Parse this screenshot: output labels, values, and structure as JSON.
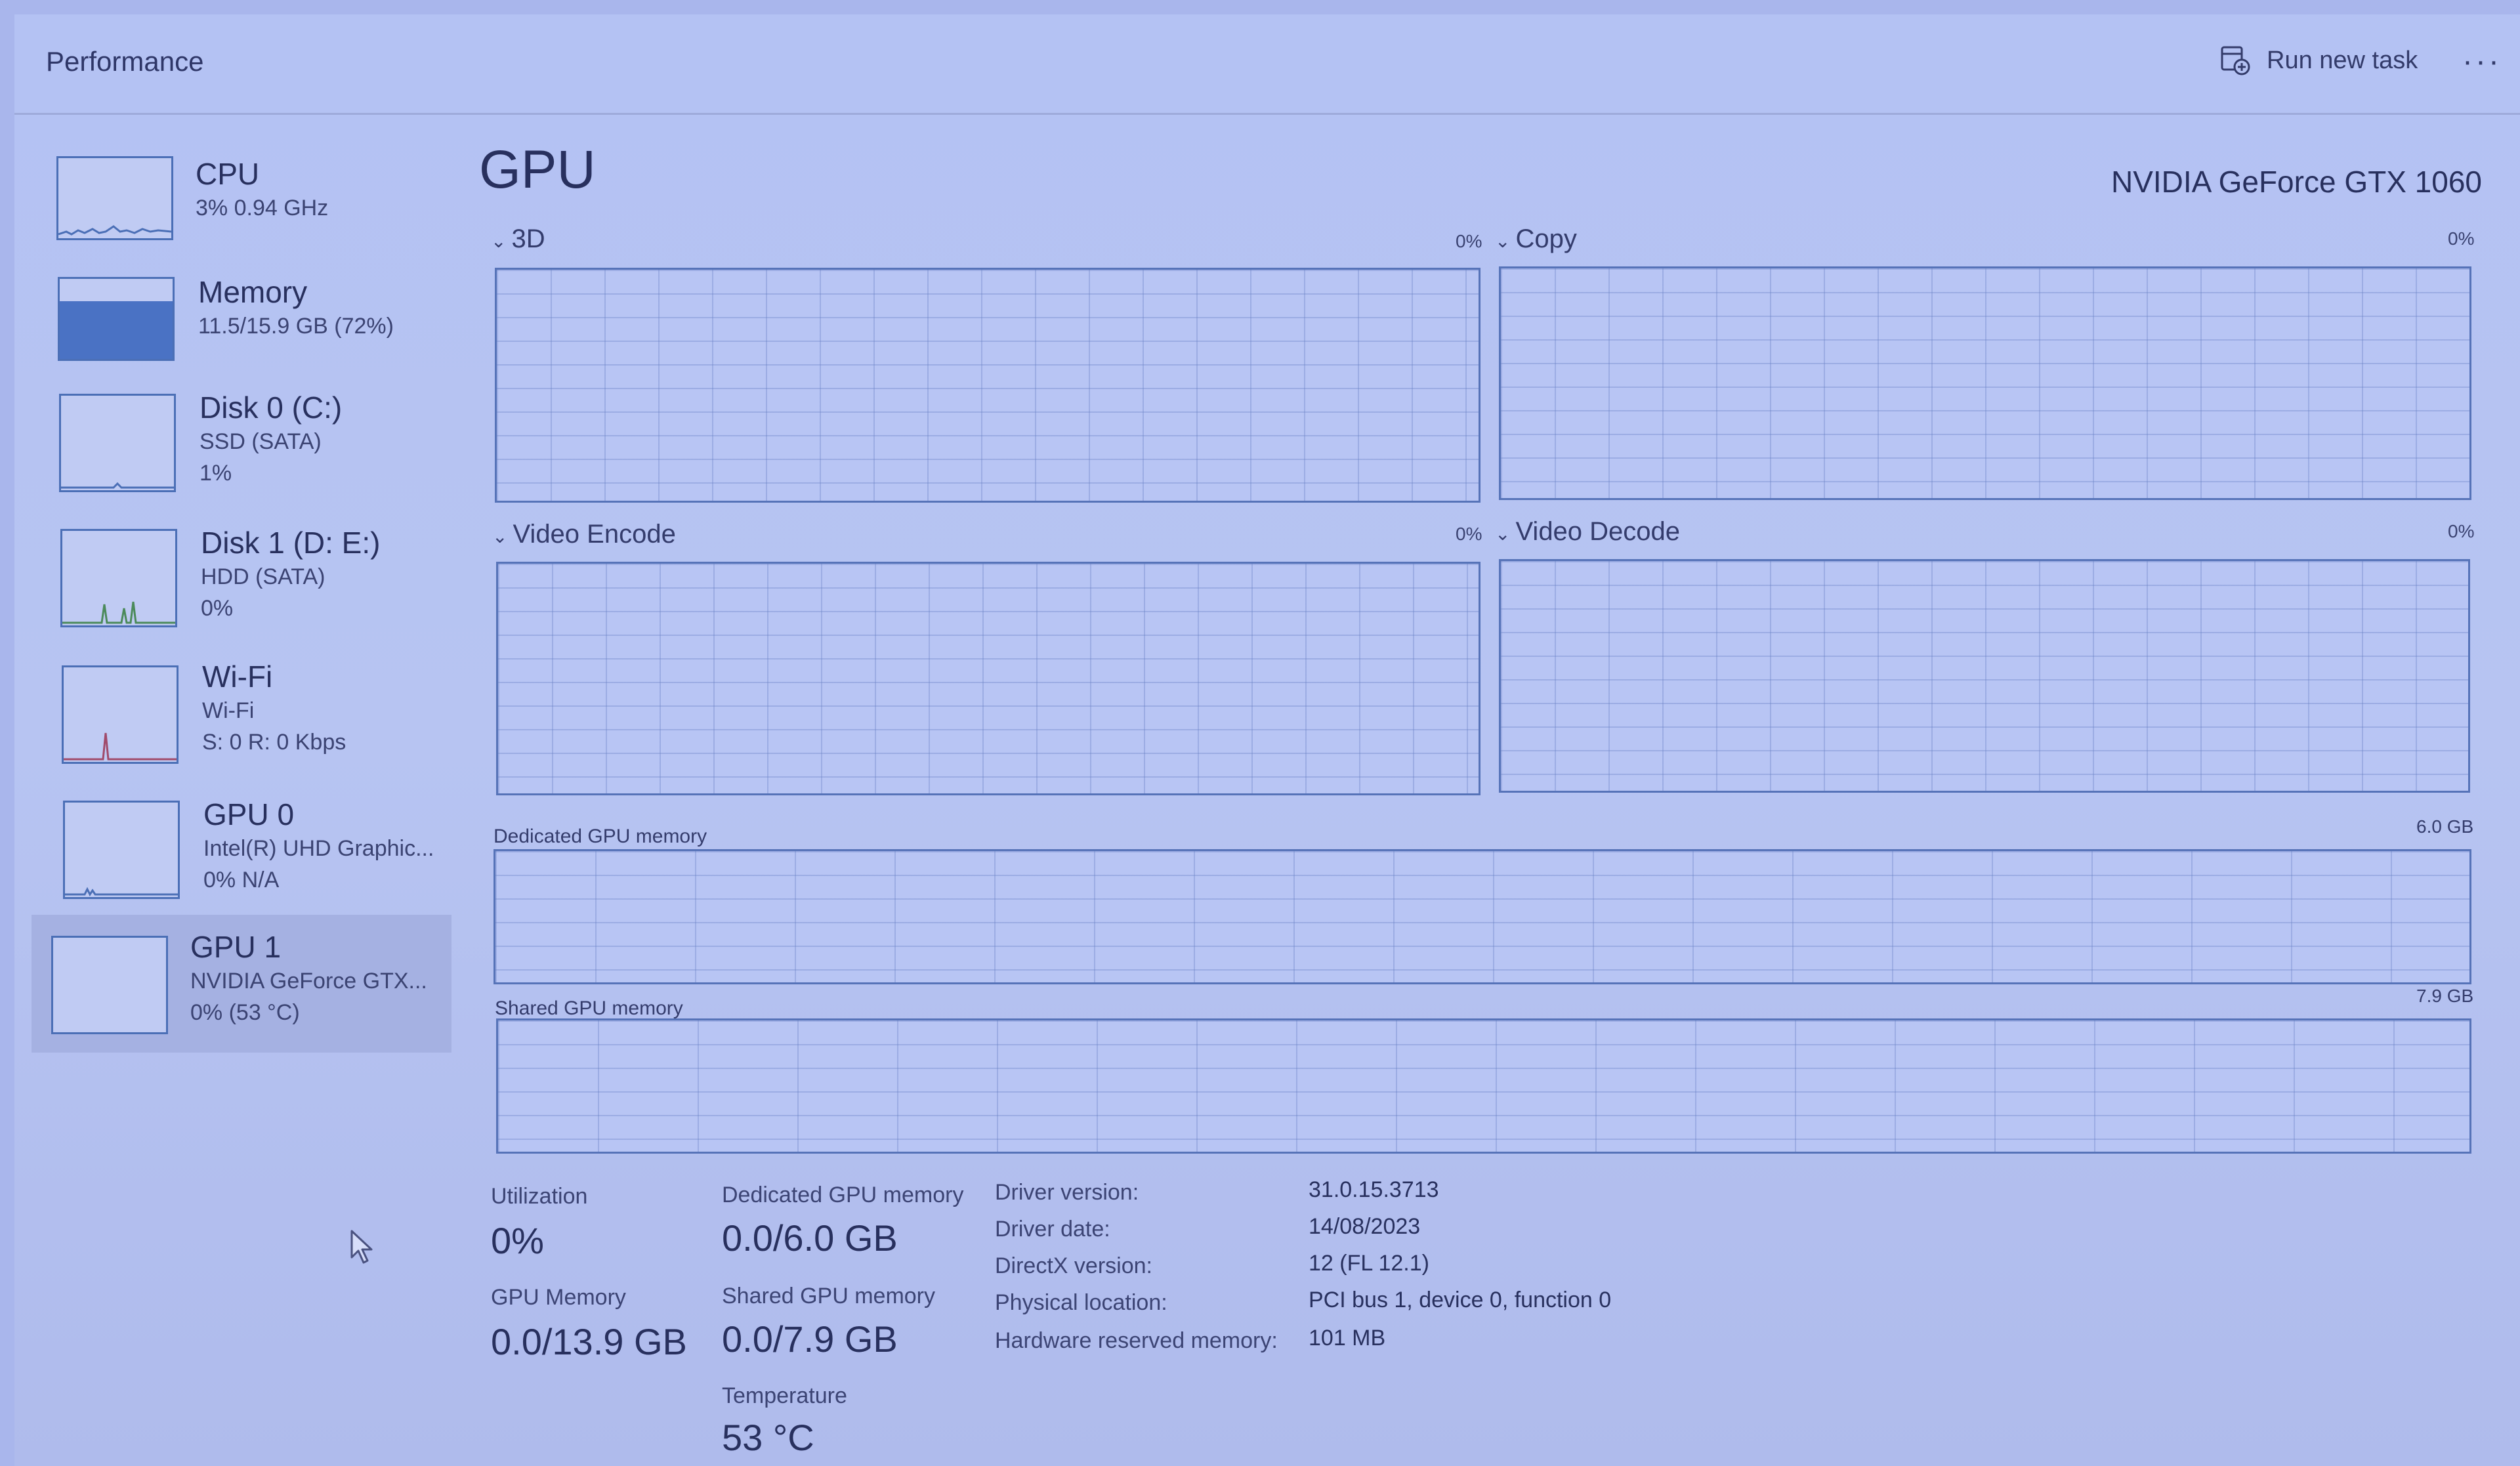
{
  "header": {
    "title": "Performance",
    "run_new_task": "Run new task",
    "more": "···"
  },
  "sidebar": {
    "items": [
      {
        "name": "CPU",
        "line1": "3% 0.94 GHz",
        "line2": ""
      },
      {
        "name": "Memory",
        "line1": "11.5/15.9 GB (72%)",
        "line2": ""
      },
      {
        "name": "Disk 0 (C:)",
        "line1": "SSD (SATA)",
        "line2": "1%"
      },
      {
        "name": "Disk 1 (D: E:)",
        "line1": "HDD (SATA)",
        "line2": "0%"
      },
      {
        "name": "Wi-Fi",
        "line1": "Wi-Fi",
        "line2": "S: 0 R: 0 Kbps"
      },
      {
        "name": "GPU 0",
        "line1": "Intel(R) UHD Graphic...",
        "line2": "0% N/A"
      },
      {
        "name": "GPU 1",
        "line1": "NVIDIA GeForce GTX...",
        "line2": "0% (53 °C)"
      }
    ],
    "selected_index": 6,
    "memory_fill_fraction": 0.72
  },
  "main": {
    "title": "GPU",
    "model": "NVIDIA GeForce GTX 1060",
    "engines": [
      {
        "label": "3D",
        "pct": "0%"
      },
      {
        "label": "Copy",
        "pct": "0%"
      },
      {
        "label": "Video Encode",
        "pct": "0%"
      },
      {
        "label": "Video Decode",
        "pct": "0%"
      }
    ],
    "dedicated_memory": {
      "label": "Dedicated GPU memory",
      "max": "6.0 GB"
    },
    "shared_memory": {
      "label": "Shared GPU memory",
      "max": "7.9 GB"
    },
    "stats": {
      "utilization_label": "Utilization",
      "utilization": "0%",
      "dedicated_label": "Dedicated GPU memory",
      "dedicated": "0.0/6.0 GB",
      "gpu_memory_label": "GPU Memory",
      "gpu_memory": "0.0/13.9 GB",
      "shared_label": "Shared GPU memory",
      "shared": "0.0/7.9 GB",
      "temperature_label": "Temperature",
      "temperature": "53 °C"
    },
    "info": [
      {
        "key": "Driver version:",
        "value": "31.0.15.3713"
      },
      {
        "key": "Driver date:",
        "value": "14/08/2023"
      },
      {
        "key": "DirectX version:",
        "value": "12 (FL 12.1)"
      },
      {
        "key": "Physical location:",
        "value": "PCI bus 1, device 0, function 0"
      },
      {
        "key": "Hardware reserved memory:",
        "value": "101 MB"
      }
    ]
  },
  "colors": {
    "accent": "#4b6fb6",
    "memory_fill": "#4a72c4",
    "background": "#b4c2f3"
  }
}
